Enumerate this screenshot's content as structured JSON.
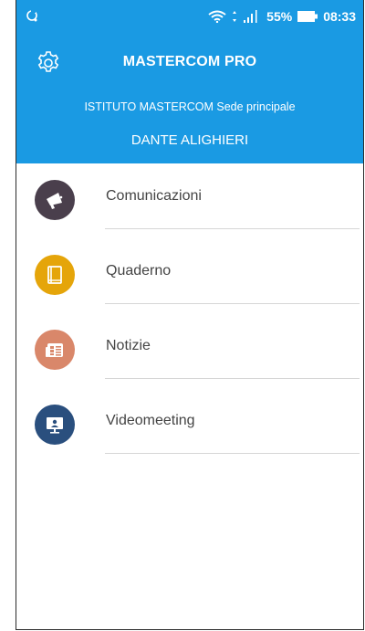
{
  "status_bar": {
    "battery_percent": "55%",
    "time": "08:33"
  },
  "header": {
    "app_title": "MASTERCOM PRO",
    "school_name": "ISTITUTO MASTERCOM Sede principale",
    "user_name": "DANTE ALIGHIERI",
    "color": "#1a9ae3"
  },
  "menu": {
    "items": [
      {
        "label": "Comunicazioni",
        "icon": "megaphone-icon",
        "color": "#4a3f4c"
      },
      {
        "label": "Quaderno",
        "icon": "notebook-icon",
        "color": "#e5a50a"
      },
      {
        "label": "Notizie",
        "icon": "newspaper-icon",
        "color": "#d9876a"
      },
      {
        "label": "Videomeeting",
        "icon": "video-presentation-icon",
        "color": "#2a4f7e"
      }
    ]
  }
}
